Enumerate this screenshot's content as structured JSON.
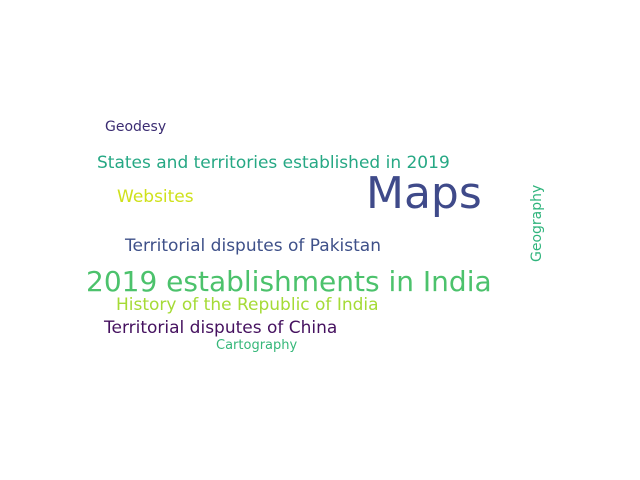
{
  "wordcloud": {
    "background": "#ffffff",
    "words": [
      {
        "text": "Maps",
        "color": "#3f4a8a"
      },
      {
        "text": "2019 establishments in India",
        "color": "#4cc26c"
      },
      {
        "text": "States and territories established in 2019",
        "color": "#26a884"
      },
      {
        "text": "Territorial disputes of Pakistan",
        "color": "#3e5089"
      },
      {
        "text": "Territorial disputes of China",
        "color": "#45115f"
      },
      {
        "text": "History of the Republic of India",
        "color": "#a5db36"
      },
      {
        "text": "Websites",
        "color": "#cfe11c"
      },
      {
        "text": "Geodesy",
        "color": "#3b2c72"
      },
      {
        "text": "Cartography",
        "color": "#35b779"
      },
      {
        "text": "Geography",
        "color": "#2fb47c"
      }
    ]
  }
}
